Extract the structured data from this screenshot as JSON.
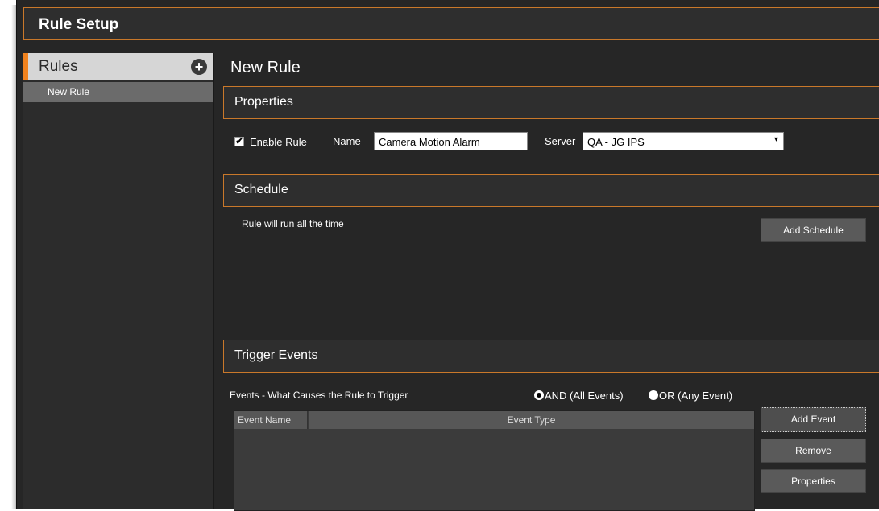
{
  "window": {
    "title": "Rule Setup"
  },
  "sidebar": {
    "header": "Rules",
    "add_icon": "plus-circle-icon",
    "items": [
      {
        "label": "New Rule"
      }
    ]
  },
  "main": {
    "title": "New Rule",
    "properties": {
      "heading": "Properties",
      "enable_label": "Enable Rule",
      "enable_checked": true,
      "name_label": "Name",
      "name_value": "Camera Motion Alarm",
      "server_label": "Server",
      "server_value": "QA - JG IPS"
    },
    "schedule": {
      "heading": "Schedule",
      "status": "Rule will run all the time",
      "add_button": "Add Schedule"
    },
    "trigger": {
      "heading": "Trigger Events",
      "description": "Events - What Causes the Rule to Trigger",
      "and_label": "AND (All Events)",
      "or_label": "OR (Any Event)",
      "selected": "AND",
      "columns": [
        "Event Name",
        "Event Type"
      ],
      "rows": [],
      "add_button": "Add Event",
      "remove_button": "Remove",
      "properties_button": "Properties"
    }
  },
  "colors": {
    "accent": "#f0821e",
    "border": "#c9782a",
    "background": "#262626"
  }
}
